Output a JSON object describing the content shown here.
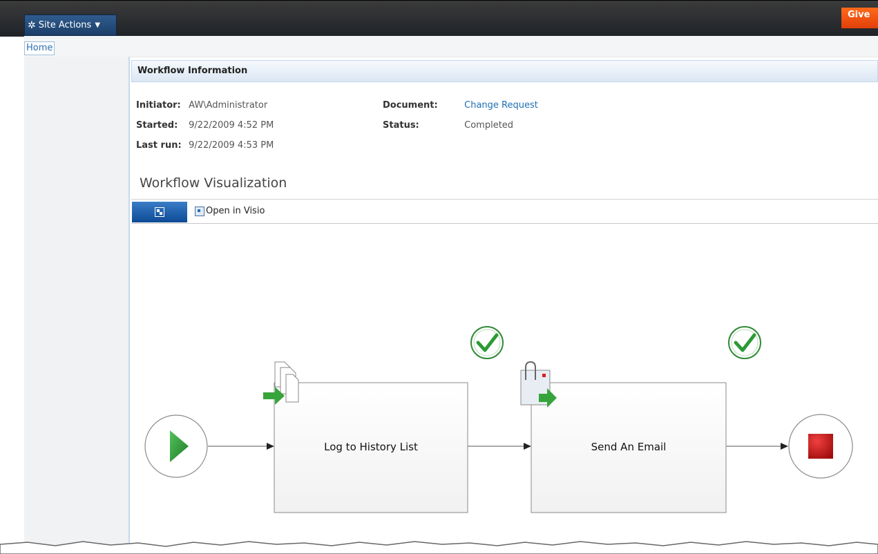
{
  "topbar": {
    "site_actions_label": "Site Actions",
    "give_label": "Give"
  },
  "breadcrumb": {
    "home_label": "Home"
  },
  "workflow_info": {
    "header": "Workflow Information",
    "initiator_label": "Initiator:",
    "initiator_value": "AW\\Administrator",
    "started_label": "Started:",
    "started_value": "9/22/2009 4:52 PM",
    "last_run_label": "Last run:",
    "last_run_value": "9/22/2009 4:53 PM",
    "document_label": "Document:",
    "document_value": "Change Request",
    "status_label": "Status:",
    "status_value": "Completed"
  },
  "visualization": {
    "title": "Workflow Visualization",
    "open_in_visio_label": "Open in Visio",
    "steps": [
      {
        "label": "Log to History List",
        "status": "completed"
      },
      {
        "label": "Send An Email",
        "status": "completed"
      }
    ]
  },
  "colors": {
    "topbar": "#2a2e33",
    "site_actions": "#24507f",
    "give": "#f0520f",
    "link": "#1f6fb5",
    "start_green": "#2e9a3a",
    "stop_red": "#c81d1d"
  },
  "icons": {
    "site_actions": "gear-icon",
    "diagram_view": "diagram-view-icon",
    "visio": "visio-icon",
    "start": "play-icon",
    "end": "stop-icon",
    "log_history": "log-history-icon",
    "email": "email-attachment-icon",
    "check": "checkmark-icon"
  }
}
